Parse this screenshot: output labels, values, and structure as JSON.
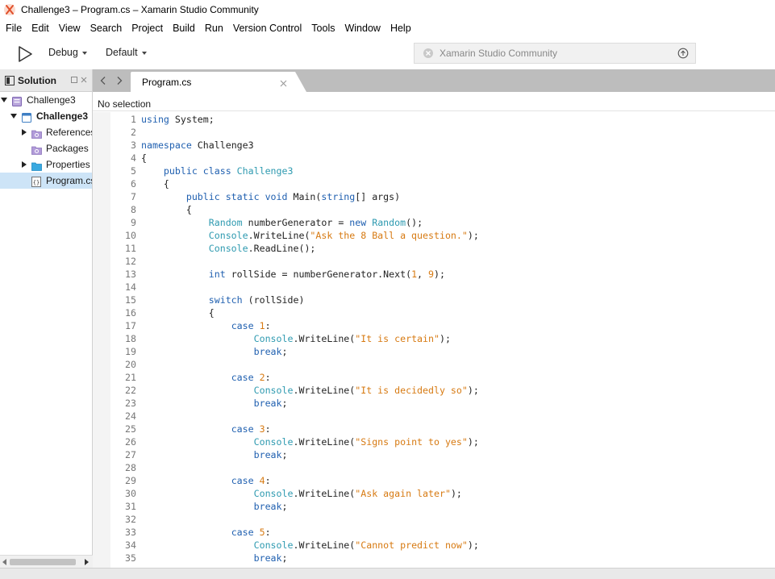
{
  "window": {
    "title": "Challenge3 – Program.cs – Xamarin Studio Community"
  },
  "menu": [
    "File",
    "Edit",
    "View",
    "Search",
    "Project",
    "Build",
    "Run",
    "Version Control",
    "Tools",
    "Window",
    "Help"
  ],
  "toolbar": {
    "config": "Debug",
    "platform": "Default",
    "status": "Xamarin Studio Community"
  },
  "solution_pad": {
    "title": "Solution",
    "items": [
      {
        "label": "Challenge3",
        "icon": "solution-icon",
        "expanded": true,
        "depth": 0
      },
      {
        "label": "Challenge3",
        "icon": "project-icon",
        "expanded": true,
        "depth": 1,
        "bold": true
      },
      {
        "label": "References",
        "icon": "references-folder-icon",
        "expanded": false,
        "depth": 2
      },
      {
        "label": "Packages",
        "icon": "packages-folder-icon",
        "depth": 2
      },
      {
        "label": "Properties",
        "icon": "folder-icon",
        "expanded": false,
        "depth": 2
      },
      {
        "label": "Program.cs",
        "icon": "csharp-file-icon",
        "depth": 2,
        "selected": true
      }
    ]
  },
  "editor": {
    "tab": "Program.cs",
    "breadcrumb": "No selection",
    "lines": [
      [
        [
          "kw",
          "using"
        ],
        [
          "t",
          " System;"
        ]
      ],
      [],
      [
        [
          "kw",
          "namespace"
        ],
        [
          "t",
          " Challenge3"
        ]
      ],
      [
        [
          "t",
          "{"
        ]
      ],
      [
        [
          "t",
          "    "
        ],
        [
          "kw",
          "public class"
        ],
        [
          "t",
          " "
        ],
        [
          "ty",
          "Challenge3"
        ]
      ],
      [
        [
          "t",
          "    {"
        ]
      ],
      [
        [
          "t",
          "        "
        ],
        [
          "kw",
          "public static void"
        ],
        [
          "t",
          " Main("
        ],
        [
          "kw",
          "string"
        ],
        [
          "t",
          "[] args)"
        ]
      ],
      [
        [
          "t",
          "        {"
        ]
      ],
      [
        [
          "t",
          "            "
        ],
        [
          "ty",
          "Random"
        ],
        [
          "t",
          " numberGenerator = "
        ],
        [
          "kw",
          "new"
        ],
        [
          "t",
          " "
        ],
        [
          "ty",
          "Random"
        ],
        [
          "t",
          "();"
        ]
      ],
      [
        [
          "t",
          "            "
        ],
        [
          "ty",
          "Console"
        ],
        [
          "t",
          ".WriteLine("
        ],
        [
          "str",
          "\"Ask the 8 Ball a question.\""
        ],
        [
          "t",
          ");"
        ]
      ],
      [
        [
          "t",
          "            "
        ],
        [
          "ty",
          "Console"
        ],
        [
          "t",
          ".ReadLine();"
        ]
      ],
      [],
      [
        [
          "t",
          "            "
        ],
        [
          "kw",
          "int"
        ],
        [
          "t",
          " rollSide = numberGenerator.Next("
        ],
        [
          "num",
          "1"
        ],
        [
          "t",
          ", "
        ],
        [
          "num",
          "9"
        ],
        [
          "t",
          ");"
        ]
      ],
      [],
      [
        [
          "t",
          "            "
        ],
        [
          "kw",
          "switch"
        ],
        [
          "t",
          " (rollSide)"
        ]
      ],
      [
        [
          "t",
          "            {"
        ]
      ],
      [
        [
          "t",
          "                "
        ],
        [
          "kw",
          "case"
        ],
        [
          "t",
          " "
        ],
        [
          "num",
          "1"
        ],
        [
          "t",
          ":"
        ]
      ],
      [
        [
          "t",
          "                    "
        ],
        [
          "ty",
          "Console"
        ],
        [
          "t",
          ".WriteLine("
        ],
        [
          "str",
          "\"It is certain\""
        ],
        [
          "t",
          ");"
        ]
      ],
      [
        [
          "t",
          "                    "
        ],
        [
          "kw",
          "break"
        ],
        [
          "t",
          ";"
        ]
      ],
      [],
      [
        [
          "t",
          "                "
        ],
        [
          "kw",
          "case"
        ],
        [
          "t",
          " "
        ],
        [
          "num",
          "2"
        ],
        [
          "t",
          ":"
        ]
      ],
      [
        [
          "t",
          "                    "
        ],
        [
          "ty",
          "Console"
        ],
        [
          "t",
          ".WriteLine("
        ],
        [
          "str",
          "\"It is decidedly so\""
        ],
        [
          "t",
          ");"
        ]
      ],
      [
        [
          "t",
          "                    "
        ],
        [
          "kw",
          "break"
        ],
        [
          "t",
          ";"
        ]
      ],
      [],
      [
        [
          "t",
          "                "
        ],
        [
          "kw",
          "case"
        ],
        [
          "t",
          " "
        ],
        [
          "num",
          "3"
        ],
        [
          "t",
          ":"
        ]
      ],
      [
        [
          "t",
          "                    "
        ],
        [
          "ty",
          "Console"
        ],
        [
          "t",
          ".WriteLine("
        ],
        [
          "str",
          "\"Signs point to yes\""
        ],
        [
          "t",
          ");"
        ]
      ],
      [
        [
          "t",
          "                    "
        ],
        [
          "kw",
          "break"
        ],
        [
          "t",
          ";"
        ]
      ],
      [],
      [
        [
          "t",
          "                "
        ],
        [
          "kw",
          "case"
        ],
        [
          "t",
          " "
        ],
        [
          "num",
          "4"
        ],
        [
          "t",
          ":"
        ]
      ],
      [
        [
          "t",
          "                    "
        ],
        [
          "ty",
          "Console"
        ],
        [
          "t",
          ".WriteLine("
        ],
        [
          "str",
          "\"Ask again later\""
        ],
        [
          "t",
          ");"
        ]
      ],
      [
        [
          "t",
          "                    "
        ],
        [
          "kw",
          "break"
        ],
        [
          "t",
          ";"
        ]
      ],
      [],
      [
        [
          "t",
          "                "
        ],
        [
          "kw",
          "case"
        ],
        [
          "t",
          " "
        ],
        [
          "num",
          "5"
        ],
        [
          "t",
          ":"
        ]
      ],
      [
        [
          "t",
          "                    "
        ],
        [
          "ty",
          "Console"
        ],
        [
          "t",
          ".WriteLine("
        ],
        [
          "str",
          "\"Cannot predict now\""
        ],
        [
          "t",
          ");"
        ]
      ],
      [
        [
          "t",
          "                    "
        ],
        [
          "kw",
          "break"
        ],
        [
          "t",
          ";"
        ]
      ]
    ]
  },
  "colors": {
    "keyword": "#2060b0",
    "type": "#2e9ab0",
    "string": "#d77a12",
    "selection": "#cde4f7",
    "tab_strip": "#bdbdbd"
  }
}
